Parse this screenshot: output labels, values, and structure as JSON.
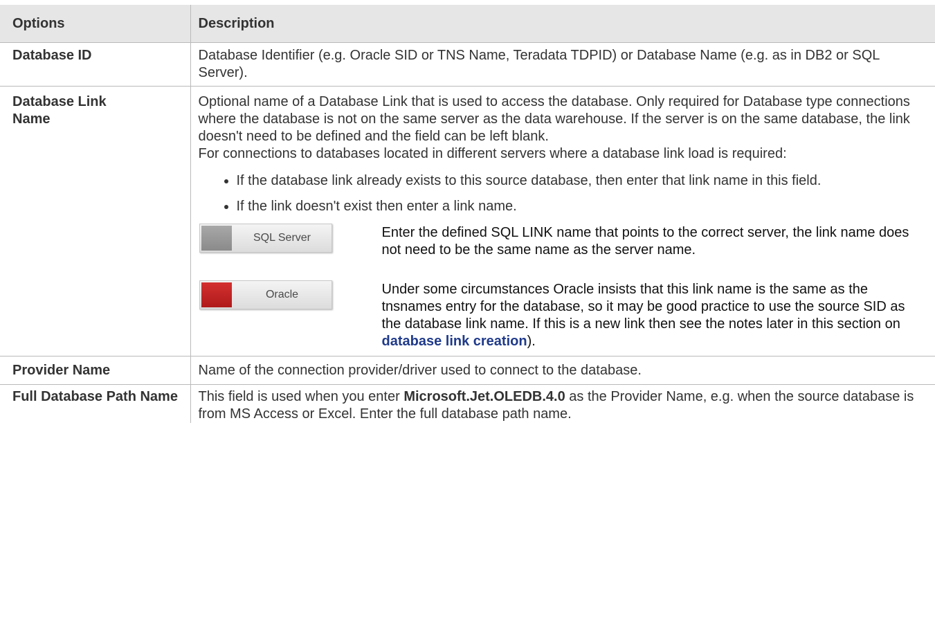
{
  "header": {
    "options": "Options",
    "description": "Description"
  },
  "rows": {
    "database_id": {
      "label": "Database ID",
      "text": "Database Identifier (e.g. Oracle SID or TNS Name, Teradata TDPID) or Database Name (e.g. as in DB2 or SQL Server)."
    },
    "database_link": {
      "label": "Database Link Name",
      "para1": "Optional name of a Database Link that is used to access the database. Only required for Database type connections where the database is not on the same server as the data warehouse. If the server is on the same database, the link doesn't need to be defined and the field can be left blank.",
      "para2": "For connections to databases located in different servers where a database link load is required:",
      "bullets": [
        "If the database link already exists to this source database, then enter that link name in this field.",
        "If the link doesn't exist then enter a link name."
      ],
      "sql_server": {
        "badge": "SQL Server",
        "text": " Enter the defined SQL LINK name that points to the correct server, the link name does not need to be the same name as the server name."
      },
      "oracle": {
        "badge": "Oracle",
        "text": " Under some circumstances Oracle insists that this link name is the same as the tnsnames entry for the database, so it may be good practice to use the source SID as the database link name. If this is a new link then see the notes later in this section on ",
        "link": "database link creation",
        "suffix": ")."
      }
    },
    "provider_name": {
      "label": "Provider Name",
      "text": "Name of the connection provider/driver used to connect to the database."
    },
    "full_path": {
      "label": "Full Database Path Name",
      "text_before": "This field is used when you enter ",
      "provider_value": "Microsoft.Jet.OLEDB.4.0",
      "text_after": " as the Provider Name, e.g. when the source database is from MS Access or Excel. Enter the full database path name."
    }
  },
  "colors": {
    "header_bg": "#e6e6e6",
    "border": "#b9b9b9",
    "link": "#1f3a8a",
    "oracle_red": "#c52222",
    "sql_gray": "#999999"
  },
  "icons": {
    "sql_server": "sql-server-badge-icon",
    "oracle": "oracle-badge-icon"
  }
}
